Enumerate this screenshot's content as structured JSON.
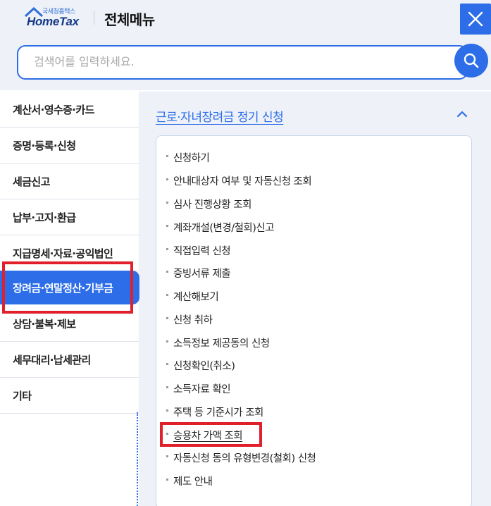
{
  "header": {
    "logo_sub": "국세청홈택스",
    "logo_main": "HomeTax",
    "title": "전체메뉴",
    "close_icon": "close-icon"
  },
  "search": {
    "placeholder": "검색어를 입력하세요.",
    "icon": "search-icon"
  },
  "left_menu": {
    "items": [
      {
        "label": "계산서·영수증·카드"
      },
      {
        "label": "증명·등록·신청"
      },
      {
        "label": "세금신고"
      },
      {
        "label": "납부·고지·환급"
      },
      {
        "label": "지급명세·자료·공익법인"
      },
      {
        "label": "장려금·연말정산·기부금",
        "active": true
      },
      {
        "label": "상담·불복·제보"
      },
      {
        "label": "세무대리·납세관리"
      },
      {
        "label": "기타"
      }
    ]
  },
  "panel": {
    "section_title": "근로·자녀장려금 정기 신청",
    "chevron_icon": "chevron-up-icon",
    "items": [
      {
        "label": "신청하기"
      },
      {
        "label": "안내대상자 여부 및 자동신청 조회"
      },
      {
        "label": "심사 진행상황 조회"
      },
      {
        "label": "계좌개설(변경/철회)신고"
      },
      {
        "label": "직접입력 신청"
      },
      {
        "label": "증빙서류 제출"
      },
      {
        "label": "계산해보기"
      },
      {
        "label": "신청 취하"
      },
      {
        "label": "소득정보 제공동의 신청"
      },
      {
        "label": "신청확인(취소)"
      },
      {
        "label": "소득자료 확인"
      },
      {
        "label": "주택 등 기준시가 조회"
      },
      {
        "label": "승용차 가액 조회",
        "highlighted": true
      },
      {
        "label": "자동신청 동의 유형변경(철회) 신청"
      },
      {
        "label": "제도 안내"
      }
    ]
  },
  "colors": {
    "accent": "#2d6ee8",
    "highlight": "#e0202b",
    "panel_bg": "#eef1f8"
  }
}
